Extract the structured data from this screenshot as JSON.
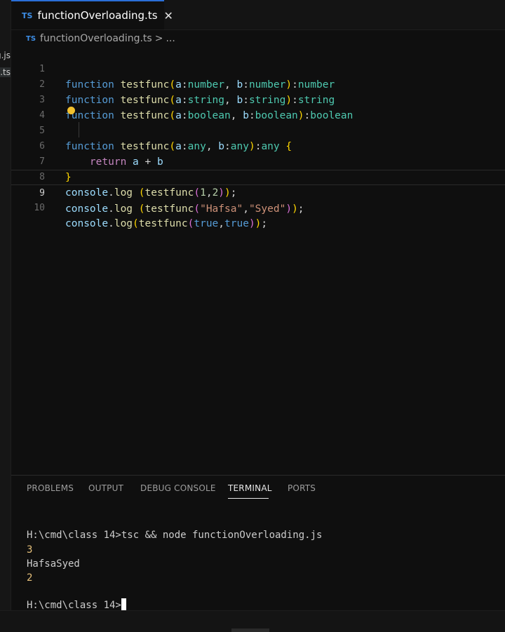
{
  "sidebar": {
    "items": [
      {
        "label": "functionOverloading.js"
      },
      {
        "label": "functionOverloading.ts"
      }
    ]
  },
  "tab": {
    "badge": "TS",
    "title": "functionOverloading.ts",
    "close": "✕"
  },
  "breadcrumb": {
    "badge": "TS",
    "file": "functionOverloading.ts",
    "separator": ">",
    "more": "..."
  },
  "editor": {
    "lines": [
      {
        "n": "1"
      },
      {
        "n": "2"
      },
      {
        "n": "3"
      },
      {
        "n": "4"
      },
      {
        "n": "5"
      },
      {
        "n": "6"
      },
      {
        "n": "7"
      },
      {
        "n": "8"
      },
      {
        "n": "9"
      },
      {
        "n": "10"
      }
    ],
    "tokens": {
      "function": "function",
      "testfunc": "testfunc",
      "a": "a",
      "b": "b",
      "number": "number",
      "string": "string",
      "boolean": "boolean",
      "any": "any",
      "return": "return",
      "console": "console",
      "log": "log",
      "true": "true",
      "one": "1",
      "two": "2",
      "hafsa": "\"Hafsa\"",
      "syed": "\"Syed\""
    }
  },
  "panel": {
    "tabs": [
      "PROBLEMS",
      "OUTPUT",
      "DEBUG CONSOLE",
      "TERMINAL",
      "PORTS"
    ],
    "active_tab": "TERMINAL",
    "terminal": {
      "command_line": "H:\\cmd\\class 14>tsc && node functionOverloading.js",
      "output": [
        "3",
        "HafsaSyed",
        "2"
      ],
      "prompt": "H:\\cmd\\class 14>"
    }
  },
  "colors": {
    "background": "#0f0f0f",
    "keyword": "#569cd6",
    "function": "#dcdcaa",
    "type": "#4ec9b0",
    "string": "#ce9178",
    "tab_accent": "#2b6fd8",
    "lightbulb": "#f2c12e"
  },
  "icons": {
    "lightbulb": "lightbulb-icon",
    "close": "close-icon",
    "chevron": "chevron-right-icon"
  }
}
